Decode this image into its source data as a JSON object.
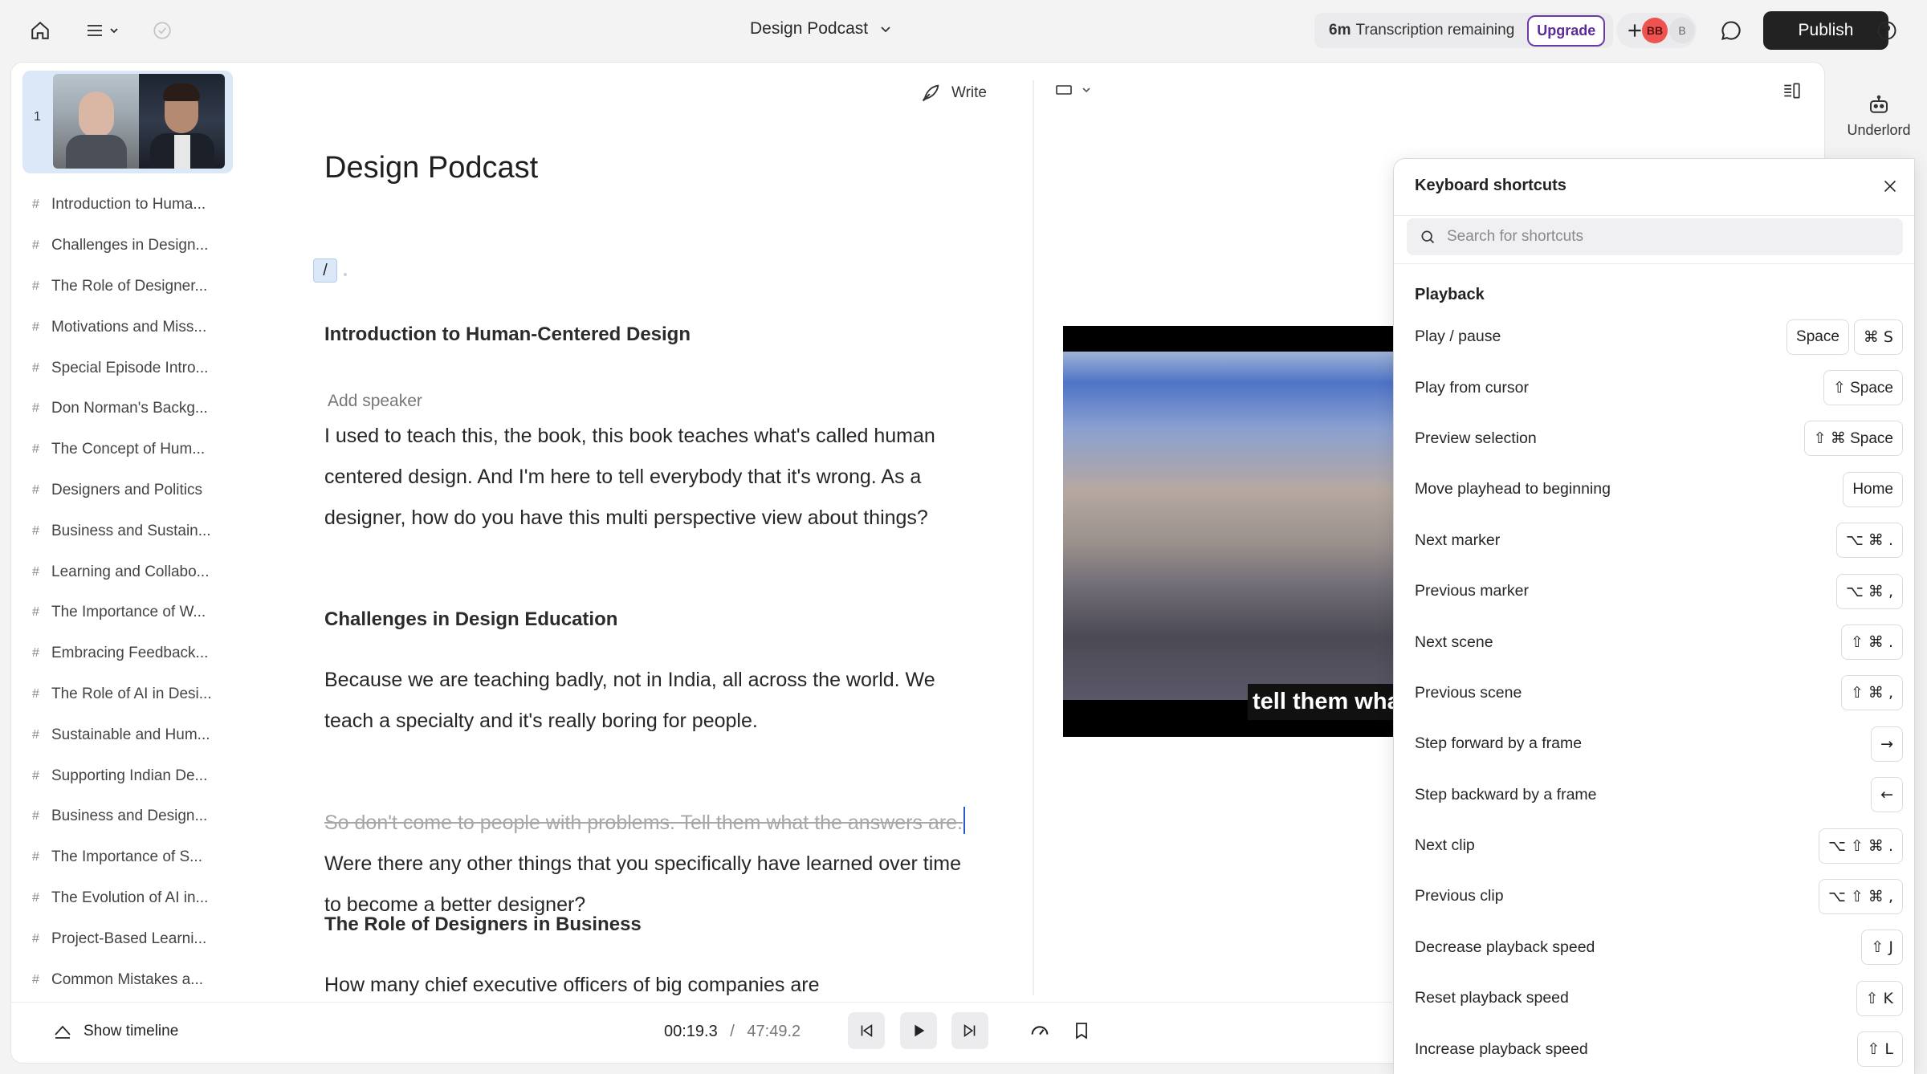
{
  "topbar": {
    "doc_title": "Design Podcast",
    "transcription_amount": "6m",
    "transcription_text": "Transcription remaining",
    "upgrade_label": "Upgrade",
    "avatar_initials": "BB",
    "avatar_b": "B",
    "publish_label": "Publish"
  },
  "scenes": {
    "number": "1",
    "items": [
      "Introduction to Huma...",
      "Challenges in Design...",
      "The Role of Designer...",
      "Motivations and Miss...",
      "Special Episode Intro...",
      "Don Norman's Backg...",
      "The Concept of Hum...",
      "Designers and Politics",
      "Business and Sustain...",
      "Learning and Collabo...",
      "The Importance of W...",
      "Embracing Feedback...",
      "The Role of AI in Desi...",
      "Sustainable and Hum...",
      "Supporting Indian De...",
      "Business and Design...",
      "The Importance of S...",
      "The Evolution of AI in...",
      "Project-Based Learni...",
      "Common Mistakes a..."
    ]
  },
  "editor": {
    "write_label": "Write",
    "title": "Design Podcast",
    "slash": "/",
    "h_intro": "Introduction to Human-Centered Design",
    "add_speaker": "Add speaker",
    "p1": "I used to teach this, the book, this book teaches what's called human centered design. And I'm here to tell everybody that it's wrong. As a designer, how do you have this multi perspective view about things?",
    "h_challenges": "Challenges in Design Education",
    "p2": "Because we are teaching badly, not in India, all across the world. We teach a specialty and it's really boring for people.",
    "p3_struck": "So don't come to people with problems. Tell them what the answers are.",
    "p3_rest": "Were there any other things that you specifically have learned over time to become a better designer?",
    "h_role": "The Role of Designers in Business",
    "p4": "How many chief executive officers of big companies are"
  },
  "video": {
    "caption": "tell them wha"
  },
  "transport": {
    "show_timeline": "Show timeline",
    "current": "00:19.3",
    "sep": "/",
    "total": "47:49.2"
  },
  "rail": {
    "underlord": "Underlord"
  },
  "shortcuts": {
    "title": "Keyboard shortcuts",
    "search_placeholder": "Search for shortcuts",
    "section": "Playback",
    "rows": [
      {
        "label": "Play / pause",
        "keys": [
          "Space",
          "⌘ S"
        ]
      },
      {
        "label": "Play from cursor",
        "keys": [
          "⇧ Space"
        ]
      },
      {
        "label": "Preview selection",
        "keys": [
          "⇧ ⌘ Space"
        ]
      },
      {
        "label": "Move playhead to beginning",
        "keys": [
          "Home"
        ]
      },
      {
        "label": "Next marker",
        "keys": [
          "⌥ ⌘ ."
        ]
      },
      {
        "label": "Previous marker",
        "keys": [
          "⌥ ⌘ ,"
        ]
      },
      {
        "label": "Next scene",
        "keys": [
          "⇧ ⌘ ."
        ]
      },
      {
        "label": "Previous scene",
        "keys": [
          "⇧ ⌘ ,"
        ]
      },
      {
        "label": "Step forward by a frame",
        "keys": [
          "→"
        ]
      },
      {
        "label": "Step backward by a frame",
        "keys": [
          "←"
        ]
      },
      {
        "label": "Next clip",
        "keys": [
          "⌥ ⇧ ⌘ ."
        ]
      },
      {
        "label": "Previous clip",
        "keys": [
          "⌥ ⇧ ⌘ ,"
        ]
      },
      {
        "label": "Decrease playback speed",
        "keys": [
          "⇧ J"
        ]
      },
      {
        "label": "Reset playback speed",
        "keys": [
          "⇧ K"
        ]
      },
      {
        "label": "Increase playback speed",
        "keys": [
          "⇧ L"
        ]
      }
    ]
  },
  "colors": {
    "accent": "#5b2c97",
    "publish_bg": "#222222",
    "selection": "#dbe8f8",
    "cursor": "#2a56c6"
  }
}
